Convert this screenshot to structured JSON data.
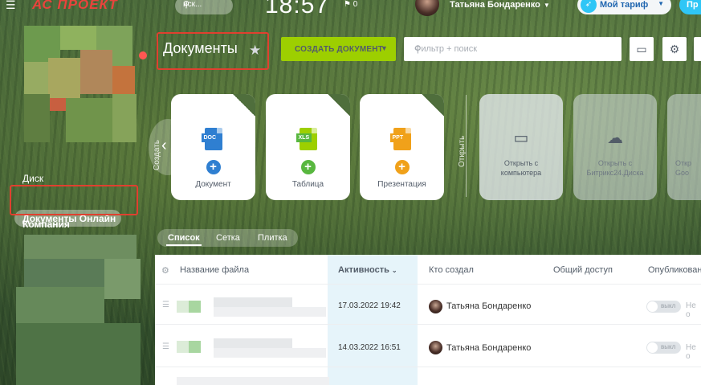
{
  "topbar": {
    "logo_text": "АС ПРОЕКТ",
    "search_placeholder": "иск...",
    "clock": "18:57",
    "notifications_count": "0",
    "user_name": "Татьяна Бондаренко",
    "tariff_label": "Мой тариф",
    "right_btn_label": "Пр"
  },
  "sidebar": {
    "items": [
      {
        "label": "Диск"
      },
      {
        "label": "Документы Онлайн",
        "active": true
      },
      {
        "label": "Компания"
      }
    ]
  },
  "header": {
    "title": "Документы",
    "create_label": "СОЗДАТЬ ДОКУМЕНТ",
    "filter_placeholder": "Фильтр + поиск"
  },
  "create_section_label": "Создать",
  "open_section_label": "Открыть",
  "create_tiles": [
    {
      "label": "Документ",
      "tag": "DOC",
      "doc_color": "#2f7fd1",
      "accent": "#2f7fd1"
    },
    {
      "label": "Таблица",
      "tag": "XLS",
      "doc_color": "#9dcf00",
      "accent": "#58b73f"
    },
    {
      "label": "Презентация",
      "tag": "PPT",
      "doc_color": "#f0a11a",
      "accent": "#f0a11a"
    }
  ],
  "open_tiles": [
    {
      "label_line1": "Открыть с",
      "label_line2": "компьютера"
    },
    {
      "label_line1": "Открыть с",
      "label_line2": "Битрикс24.Диска"
    },
    {
      "label_line1": "Откр",
      "label_line2": "Goo"
    }
  ],
  "view_tabs": [
    "Список",
    "Сетка",
    "Плитка"
  ],
  "table": {
    "columns": [
      "Название файла",
      "Активность",
      "Кто создал",
      "Общий доступ",
      "Опубликован"
    ],
    "rows": [
      {
        "date": "17.03.2022 19:42",
        "creator": "Татьяна Бондаренко",
        "toggle": "выкл",
        "published": "Не о"
      },
      {
        "date": "14.03.2022 16:51",
        "creator": "Татьяна Бондаренко",
        "toggle": "выкл",
        "published": "Не о"
      }
    ]
  },
  "colors": {
    "accent_green": "#9dcf00",
    "highlight_red": "#e0402f",
    "brand_blue": "#2fc6f6"
  }
}
